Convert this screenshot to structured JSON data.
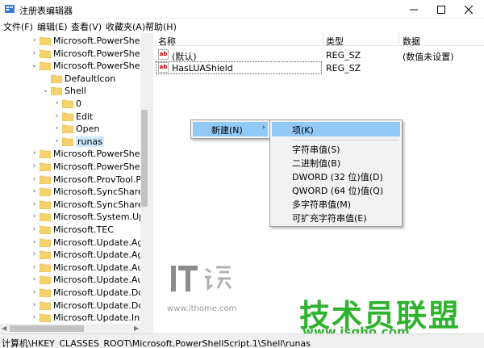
{
  "window": {
    "title": "注册表编辑器",
    "icons": [
      "regedit-icon",
      "minimize-icon",
      "maximize-icon",
      "close-icon"
    ]
  },
  "menu": [
    "文件(F)",
    "编辑(E)",
    "查看(V)",
    "收藏夹(A)",
    "帮助(H)"
  ],
  "tree": {
    "items": [
      {
        "label": "Microsoft.PowerShellDa",
        "expanded": false
      },
      {
        "label": "Microsoft.PowerShellMo",
        "expanded": false
      },
      {
        "label": "Microsoft.PowerShellScr",
        "expanded": true
      },
      {
        "label": "DefaultIcon",
        "expanded": null
      },
      {
        "label": "Shell",
        "expanded": true
      },
      {
        "label": "0",
        "expanded": false
      },
      {
        "label": "Edit",
        "expanded": false
      },
      {
        "label": "Open",
        "expanded": false
      },
      {
        "label": "runas",
        "expanded": false,
        "selected": true
      },
      {
        "label": "Microsoft.PowerShellSes",
        "expanded": false
      },
      {
        "label": "Microsoft.PowerShellXM",
        "expanded": false
      },
      {
        "label": "Microsoft.ProvTool.Prov",
        "expanded": false
      },
      {
        "label": "Microsoft.SyncShare.Syn",
        "expanded": false
      },
      {
        "label": "Microsoft.SyncShare.Syn",
        "expanded": false
      },
      {
        "label": "Microsoft.System.Updat",
        "expanded": false
      },
      {
        "label": "Microsoft.TEC",
        "expanded": false
      },
      {
        "label": "Microsoft.Update.Agent",
        "expanded": false
      },
      {
        "label": "Microsoft.Update.Agent",
        "expanded": false
      },
      {
        "label": "Microsoft.Update.AutoU",
        "expanded": false
      },
      {
        "label": "Microsoft.Update.AutoU",
        "expanded": false
      },
      {
        "label": "Microsoft.Update.Down",
        "expanded": false
      },
      {
        "label": "Microsoft.Update.Down",
        "expanded": false
      },
      {
        "label": "Microsoft.Update.Install",
        "expanded": false
      }
    ]
  },
  "list": {
    "columns": [
      "名称",
      "类型",
      "数据"
    ],
    "rows": [
      {
        "icon": "ab",
        "name": "(默认)",
        "type": "REG_SZ",
        "data": "(数值未设置)"
      },
      {
        "icon": "ab",
        "name": "HasLUAShield",
        "type": "REG_SZ",
        "data": ""
      }
    ]
  },
  "context_menu": {
    "new_label": "新建(N)",
    "submenu_arrow": "›",
    "submenu": [
      "项(K)",
      "字符串值(S)",
      "二进制值(B)",
      "DWORD (32 位)值(D)",
      "QWORD (64 位)值(Q)",
      "多字符串值(M)",
      "可扩充字符串值(E)"
    ]
  },
  "statusbar": "计算机\\HKEY_CLASSES_ROOT\\Microsoft.PowerShellScript.1\\Shell\\runas",
  "watermarks": {
    "ithome_url": "www.ithome.com",
    "jsgho_title": "技术员联盟",
    "jsgho_url": "www.jsgho.com"
  },
  "colors": {
    "highlight": "#91c9f7",
    "selection": "#cce8ff",
    "folder": "#f5d26e",
    "watermark_green": "#2fb32f"
  }
}
